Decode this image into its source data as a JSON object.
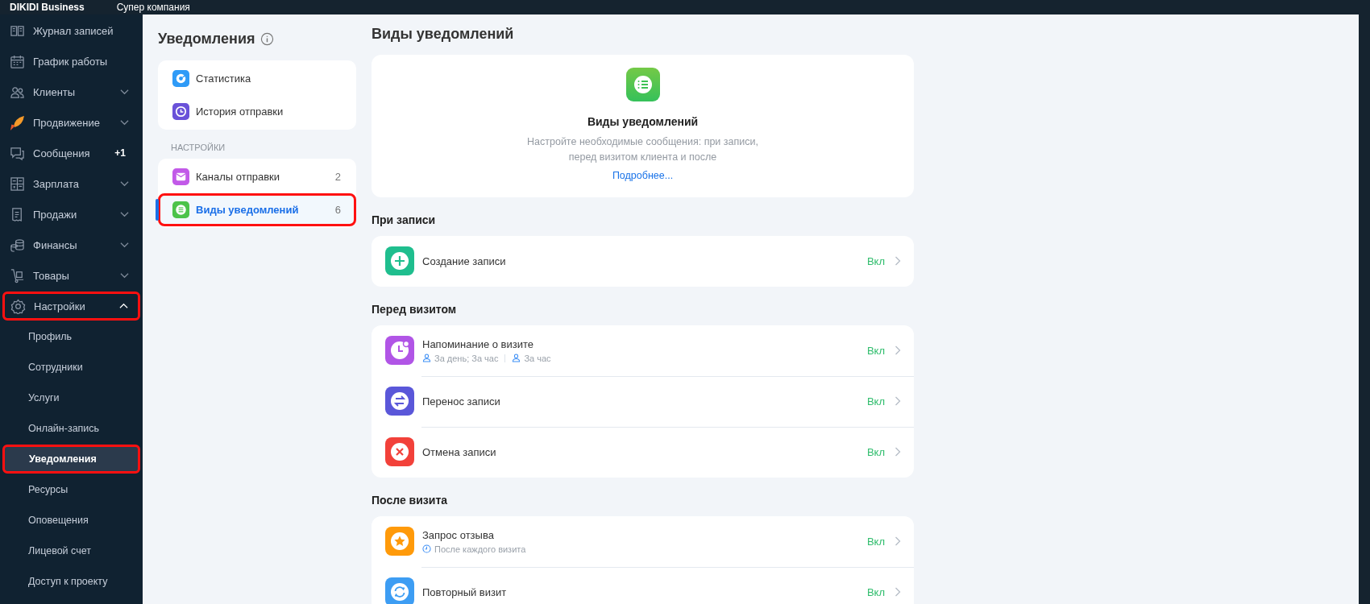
{
  "top_bar": {
    "brand": "DIKIDI Business",
    "company": "Супер компания"
  },
  "sidebar": {
    "items": [
      {
        "label": "Журнал записей",
        "kind": "journal",
        "selected": false,
        "highlighted": false
      },
      {
        "label": "График работы",
        "kind": "calendar",
        "selected": false,
        "highlighted": false
      },
      {
        "label": "Клиенты",
        "kind": "clients",
        "expanded": false,
        "selected": false,
        "highlighted": false
      },
      {
        "label": "Продвижение",
        "kind": "rocket",
        "expanded": false,
        "selected": false,
        "highlighted": false
      },
      {
        "label": "Сообщения",
        "kind": "messages",
        "badge": "+1",
        "selected": false,
        "highlighted": false
      },
      {
        "label": "Зарплата",
        "kind": "salary",
        "expanded": false,
        "selected": false,
        "highlighted": false
      },
      {
        "label": "Продажи",
        "kind": "sales",
        "expanded": false,
        "selected": false,
        "highlighted": false
      },
      {
        "label": "Финансы",
        "kind": "finance",
        "expanded": false,
        "selected": false,
        "highlighted": false
      },
      {
        "label": "Товары",
        "kind": "goods",
        "expanded": false,
        "selected": false,
        "highlighted": false
      },
      {
        "label": "Настройки",
        "kind": "settings",
        "expanded": true,
        "highlighted": true,
        "selected": false,
        "children": [
          {
            "label": "Профиль",
            "selected": false,
            "highlighted": false
          },
          {
            "label": "Сотрудники",
            "selected": false,
            "highlighted": false
          },
          {
            "label": "Услуги",
            "selected": false,
            "highlighted": false
          },
          {
            "label": "Онлайн-запись",
            "selected": false,
            "highlighted": false
          },
          {
            "label": "Уведомления",
            "selected": true,
            "highlighted": true
          },
          {
            "label": "Ресурсы",
            "selected": false,
            "highlighted": false
          },
          {
            "label": "Оповещения",
            "selected": false,
            "highlighted": false
          },
          {
            "label": "Лицевой счет",
            "selected": false,
            "highlighted": false
          },
          {
            "label": "Доступ к проекту",
            "selected": false,
            "highlighted": false
          }
        ]
      }
    ]
  },
  "section_panel": {
    "title": "Уведомления",
    "groups": [
      {
        "items": [
          {
            "label": "Статистика",
            "kind": "stats",
            "selected": false,
            "highlighted": false
          },
          {
            "label": "История отправки",
            "kind": "history",
            "selected": false,
            "highlighted": false
          }
        ]
      },
      {
        "heading": "НАСТРОЙКИ",
        "items": [
          {
            "label": "Каналы отправки",
            "kind": "channels",
            "count": "2",
            "selected": false,
            "highlighted": false
          },
          {
            "label": "Виды уведомлений",
            "kind": "types",
            "count": "6",
            "selected": true,
            "highlighted": true
          }
        ]
      }
    ]
  },
  "main": {
    "title": "Виды уведомлений",
    "intro": {
      "title": "Виды уведомлений",
      "text": "Настройте необходимые сообщения: при записи, перед визитом клиента и после",
      "link": "Подробнее..."
    },
    "sections": [
      {
        "title": "При записи",
        "rows": [
          {
            "label": "Создание записи",
            "kind": "plus",
            "status": "Вкл"
          }
        ]
      },
      {
        "title": "Перед визитом",
        "rows": [
          {
            "label": "Напоминание о визите",
            "kind": "reminder",
            "status": "Вкл",
            "details": [
              {
                "kind": "person",
                "text": "За день; За час"
              },
              {
                "kind": "person",
                "text": "За час"
              }
            ]
          },
          {
            "label": "Перенос записи",
            "kind": "swap",
            "status": "Вкл"
          },
          {
            "label": "Отмена записи",
            "kind": "cancel",
            "status": "Вкл"
          }
        ]
      },
      {
        "title": "После визита",
        "rows": [
          {
            "label": "Запрос отзыва",
            "kind": "star",
            "status": "Вкл",
            "details": [
              {
                "kind": "clock",
                "text": "После каждого визита"
              }
            ]
          },
          {
            "label": "Повторный визит",
            "kind": "repeat",
            "status": "Вкл"
          }
        ]
      }
    ]
  }
}
